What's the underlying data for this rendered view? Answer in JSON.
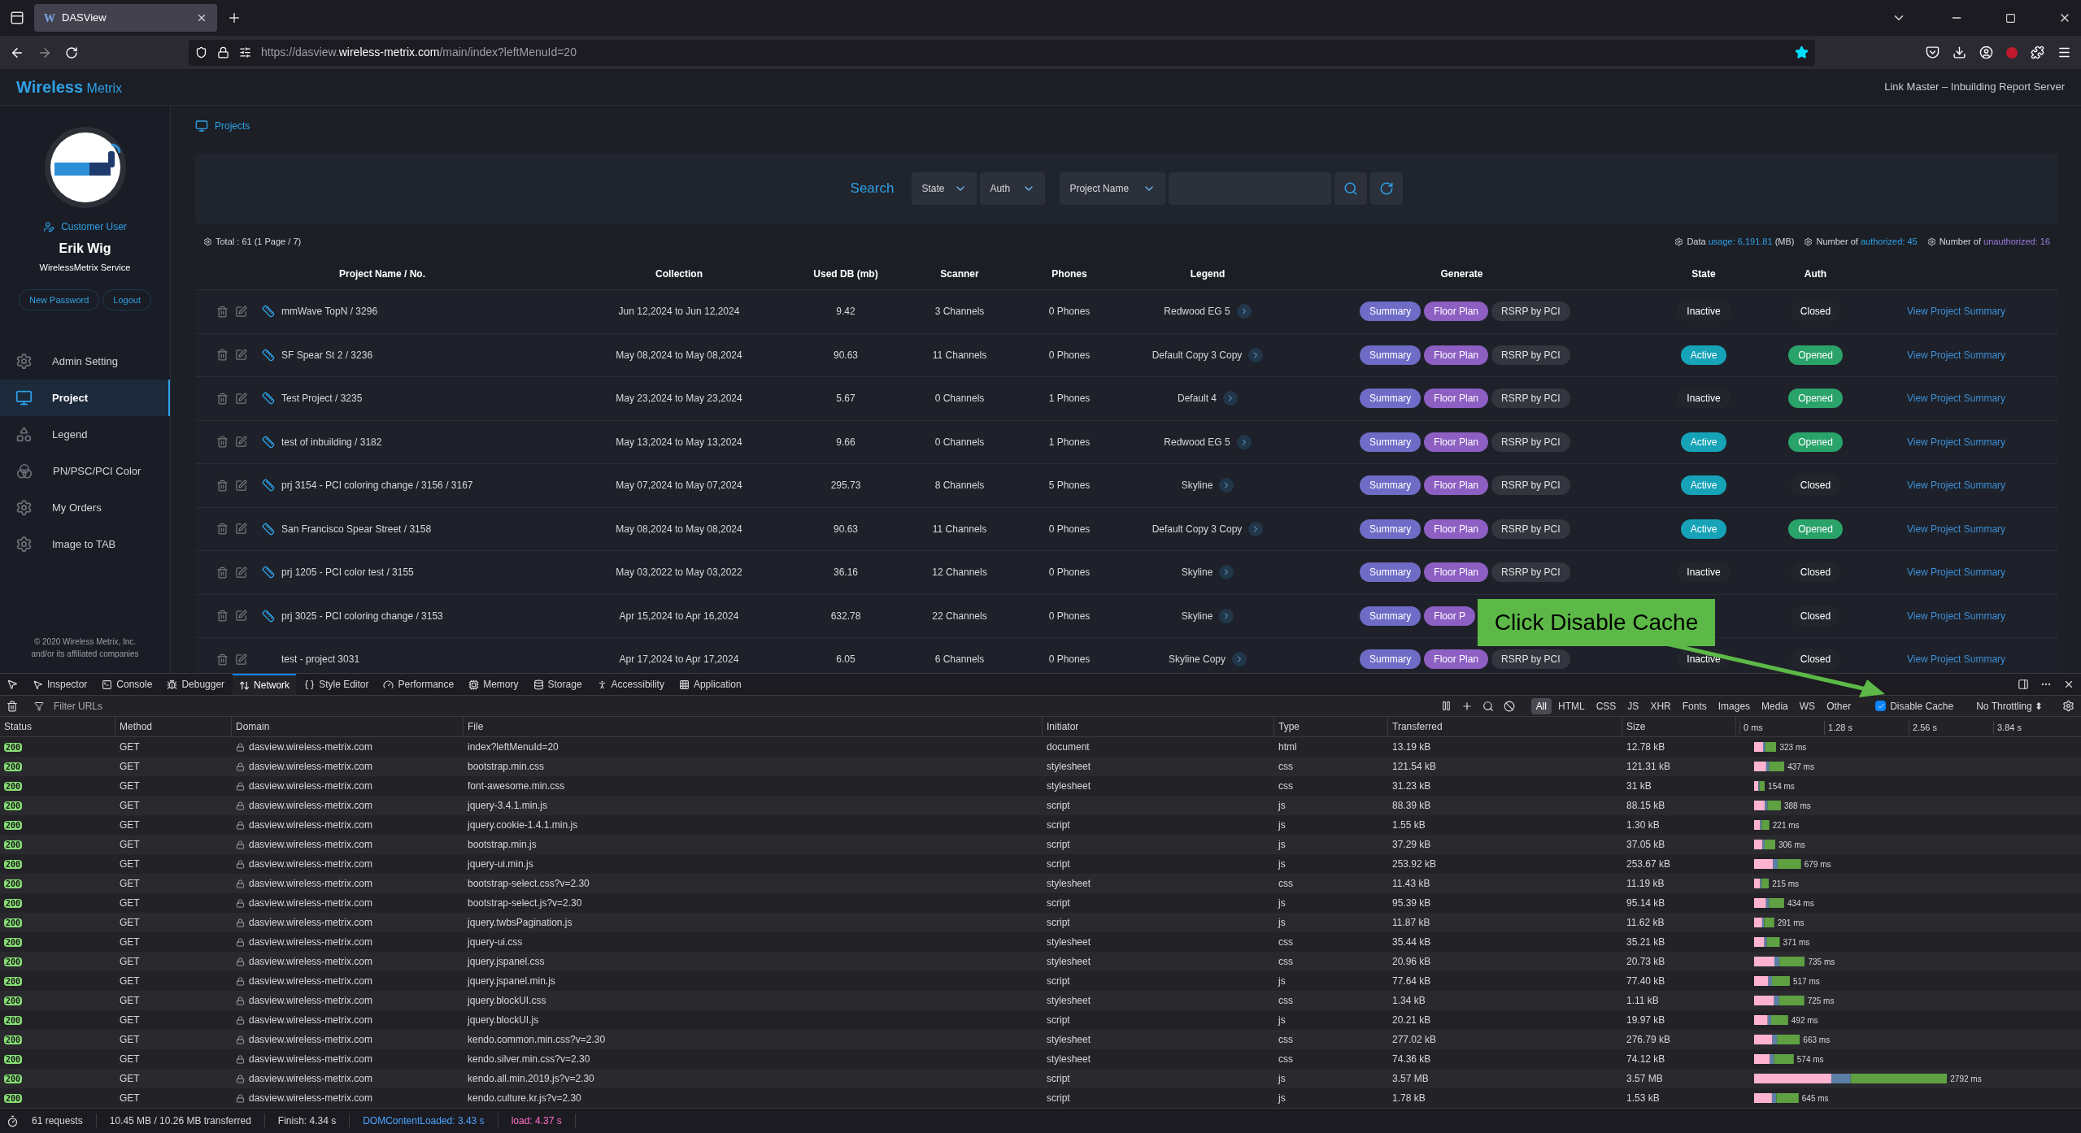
{
  "browser": {
    "tab": {
      "favicon": "W",
      "title": "DASView"
    },
    "url": {
      "scheme": "https://",
      "domain_pre": "dasview.",
      "domain": "wireless-metrix.com",
      "path": "/main/index?leftMenuId=20"
    }
  },
  "header": {
    "brand": "Wireless",
    "brand_sub": "Metrix",
    "tagline": "Link Master – Inbuilding Report Server"
  },
  "sidebar": {
    "role": "Customer User",
    "user": "Erik Wig",
    "company": "WirelessMetrix Service",
    "buttons": [
      "New Password",
      "Logout"
    ],
    "items": [
      {
        "label": "Admin Setting",
        "selected": false
      },
      {
        "label": "Project",
        "selected": true
      },
      {
        "label": "Legend",
        "selected": false
      },
      {
        "label": "PN/PSC/PCI Color",
        "selected": false
      },
      {
        "label": "My Orders",
        "selected": false
      },
      {
        "label": "Image to TAB",
        "selected": false
      }
    ],
    "footer": [
      "© 2020 Wireless Metrix, Inc.",
      "and/or its affiliated companies"
    ]
  },
  "breadcrumb": "Projects",
  "search": {
    "label": "Search",
    "dropdowns": [
      "State",
      "Auth",
      "Project Name"
    ]
  },
  "summary": {
    "total": "Total : 61 (1 Page / 7)",
    "stats": [
      {
        "pre": "Data",
        "value": "usage: 6,191.81",
        "post": "(MB)",
        "kind": "data"
      },
      {
        "pre": "Number of",
        "value": "authorized: 45",
        "kind": "data"
      },
      {
        "pre": "Number of",
        "value": "unauthorized: 16",
        "kind": "alt"
      }
    ]
  },
  "table": {
    "columns": [
      "Project Name / No.",
      "Collection",
      "Used DB (mb)",
      "Scanner",
      "Phones",
      "Legend",
      "Generate",
      "State",
      "Auth"
    ],
    "rows": [
      {
        "name": "mmWave TopN / 3296",
        "linked": true,
        "collection": "Jun 12,2024 to Jun 12,2024",
        "used_db": "9.42",
        "scanner": "3 Channels",
        "phones": "0 Phones",
        "legend": "Redwood EG 5",
        "generate": [
          {
            "label": "Summary",
            "kind": "summary"
          },
          {
            "label": "Floor Plan",
            "kind": "floor"
          },
          {
            "label": "RSRP by PCI",
            "kind": "plain"
          }
        ],
        "state": {
          "label": "Inactive",
          "active": false
        },
        "auth": {
          "label": "Closed",
          "opened": false
        },
        "link": "View Project Summary"
      },
      {
        "name": "SF Spear St 2 / 3236",
        "linked": true,
        "collection": "May 08,2024 to May 08,2024",
        "used_db": "90.63",
        "scanner": "11 Channels",
        "phones": "0 Phones",
        "legend": "Default Copy 3 Copy",
        "generate": [
          {
            "label": "Summary",
            "kind": "summary"
          },
          {
            "label": "Floor Plan",
            "kind": "floor"
          },
          {
            "label": "RSRP by PCI",
            "kind": "plain"
          }
        ],
        "state": {
          "label": "Active",
          "active": true
        },
        "auth": {
          "label": "Opened",
          "opened": true
        },
        "link": "View Project Summary"
      },
      {
        "name": "Test Project / 3235",
        "linked": true,
        "collection": "May 23,2024 to May 23,2024",
        "used_db": "5.67",
        "scanner": "0 Channels",
        "phones": "1 Phones",
        "legend": "Default 4",
        "generate": [
          {
            "label": "Summary",
            "kind": "summary"
          },
          {
            "label": "Floor Plan",
            "kind": "floor"
          },
          {
            "label": "RSRP by PCI",
            "kind": "plain"
          }
        ],
        "state": {
          "label": "Inactive",
          "active": false
        },
        "auth": {
          "label": "Opened",
          "opened": true
        },
        "link": "View Project Summary"
      },
      {
        "name": "test of inbuilding / 3182",
        "linked": true,
        "collection": "May 13,2024 to May 13,2024",
        "used_db": "9.66",
        "scanner": "0 Channels",
        "phones": "1 Phones",
        "legend": "Redwood EG 5",
        "generate": [
          {
            "label": "Summary",
            "kind": "summary"
          },
          {
            "label": "Floor Plan",
            "kind": "floor"
          },
          {
            "label": "RSRP by PCI",
            "kind": "plain"
          }
        ],
        "state": {
          "label": "Active",
          "active": true
        },
        "auth": {
          "label": "Opened",
          "opened": true
        },
        "link": "View Project Summary"
      },
      {
        "name": "prj 3154 - PCI coloring change / 3156 / 3167",
        "linked": true,
        "collection": "May 07,2024 to May 07,2024",
        "used_db": "295.73",
        "scanner": "8 Channels",
        "phones": "5 Phones",
        "legend": "Skyline",
        "generate": [
          {
            "label": "Summary",
            "kind": "summary"
          },
          {
            "label": "Floor Plan",
            "kind": "floor"
          },
          {
            "label": "RSRP by PCI",
            "kind": "plain"
          }
        ],
        "state": {
          "label": "Active",
          "active": true
        },
        "auth": {
          "label": "Closed",
          "opened": false
        },
        "link": "View Project Summary"
      },
      {
        "name": "San Francisco Spear Street / 3158",
        "linked": true,
        "collection": "May 08,2024 to May 08,2024",
        "used_db": "90.63",
        "scanner": "11 Channels",
        "phones": "0 Phones",
        "legend": "Default Copy 3 Copy",
        "generate": [
          {
            "label": "Summary",
            "kind": "summary"
          },
          {
            "label": "Floor Plan",
            "kind": "floor"
          },
          {
            "label": "RSRP by PCI",
            "kind": "plain"
          }
        ],
        "state": {
          "label": "Active",
          "active": true
        },
        "auth": {
          "label": "Opened",
          "opened": true
        },
        "link": "View Project Summary"
      },
      {
        "name": "prj 1205 - PCI color test / 3155",
        "linked": true,
        "collection": "May 03,2022 to May 03,2022",
        "used_db": "36.16",
        "scanner": "12 Channels",
        "phones": "0 Phones",
        "legend": "Skyline",
        "generate": [
          {
            "label": "Summary",
            "kind": "summary"
          },
          {
            "label": "Floor Plan",
            "kind": "floor"
          },
          {
            "label": "RSRP by PCI",
            "kind": "plain"
          }
        ],
        "state": {
          "label": "Inactive",
          "active": false
        },
        "auth": {
          "label": "Closed",
          "opened": false
        },
        "link": "View Project Summary"
      },
      {
        "name": "prj 3025 - PCI coloring change / 3153",
        "linked": true,
        "collection": "Apr 15,2024 to Apr 16,2024",
        "used_db": "632.78",
        "scanner": "22 Channels",
        "phones": "0 Phones",
        "legend": "Skyline",
        "generate": [
          {
            "label": "Summary",
            "kind": "summary"
          },
          {
            "label": "Floor P",
            "kind": "floor"
          }
        ],
        "auth": {
          "label": "Closed",
          "opened": false
        },
        "link": "View Project Summary"
      },
      {
        "name": "test - project 3031",
        "linked": false,
        "collection": "Apr 17,2024 to Apr 17,2024",
        "used_db": "6.05",
        "scanner": "6 Channels",
        "phones": "0 Phones",
        "legend": "Skyline Copy",
        "generate": [
          {
            "label": "Summary",
            "kind": "summary"
          },
          {
            "label": "Floor Plan",
            "kind": "floor"
          },
          {
            "label": "RSRP by PCI",
            "kind": "plain"
          }
        ],
        "state": {
          "label": "Inactive",
          "active": false
        },
        "auth": {
          "label": "Closed",
          "opened": false
        },
        "link": "View Project Summary"
      }
    ]
  },
  "annotation": {
    "text": "Click Disable Cache"
  },
  "devtools": {
    "tabs": [
      {
        "label": "Inspector",
        "selected": false
      },
      {
        "label": "Console",
        "selected": false
      },
      {
        "label": "Debugger",
        "selected": false
      },
      {
        "label": "Network",
        "selected": true
      },
      {
        "label": "Style Editor",
        "selected": false
      },
      {
        "label": "Performance",
        "selected": false
      },
      {
        "label": "Memory",
        "selected": false
      },
      {
        "label": "Storage",
        "selected": false
      },
      {
        "label": "Accessibility",
        "selected": false
      },
      {
        "label": "Application",
        "selected": false
      }
    ],
    "filter_placeholder": "Filter URLs",
    "type_filters": [
      {
        "label": "All",
        "selected": true
      },
      {
        "label": "HTML",
        "selected": false
      },
      {
        "label": "CSS",
        "selected": false
      },
      {
        "label": "JS",
        "selected": false
      },
      {
        "label": "XHR",
        "selected": false
      },
      {
        "label": "Fonts",
        "selected": false
      },
      {
        "label": "Images",
        "selected": false
      },
      {
        "label": "Media",
        "selected": false
      },
      {
        "label": "WS",
        "selected": false
      },
      {
        "label": "Other",
        "selected": false
      }
    ],
    "disable_cache": {
      "label": "Disable Cache",
      "checked": true
    },
    "throttling": "No Throttling ⬍",
    "columns": [
      "Status",
      "Method",
      "Domain",
      "File",
      "Initiator",
      "Type",
      "Transferred",
      "Size"
    ],
    "ticks": [
      "0 ms",
      "1.28 s",
      "2.56 s",
      "3.84 s"
    ],
    "requests": [
      {
        "status": "200",
        "method": "GET",
        "domain": "dasview.wireless-metrix.com",
        "file": "index?leftMenuId=20",
        "initiator": "document",
        "type": "html",
        "transferred": "13.19 kB",
        "size": "12.78 kB",
        "time": "323 ms"
      },
      {
        "status": "200",
        "method": "GET",
        "domain": "dasview.wireless-metrix.com",
        "file": "bootstrap.min.css",
        "initiator": "stylesheet",
        "type": "css",
        "transferred": "121.54 kB",
        "size": "121.31 kB",
        "time": "437 ms"
      },
      {
        "status": "200",
        "method": "GET",
        "domain": "dasview.wireless-metrix.com",
        "file": "font-awesome.min.css",
        "initiator": "stylesheet",
        "type": "css",
        "transferred": "31.23 kB",
        "size": "31 kB",
        "time": "154 ms"
      },
      {
        "status": "200",
        "method": "GET",
        "domain": "dasview.wireless-metrix.com",
        "file": "jquery-3.4.1.min.js",
        "initiator": "script",
        "type": "js",
        "transferred": "88.39 kB",
        "size": "88.15 kB",
        "time": "388 ms"
      },
      {
        "status": "200",
        "method": "GET",
        "domain": "dasview.wireless-metrix.com",
        "file": "jquery.cookie-1.4.1.min.js",
        "initiator": "script",
        "type": "js",
        "transferred": "1.55 kB",
        "size": "1.30 kB",
        "time": "221 ms"
      },
      {
        "status": "200",
        "method": "GET",
        "domain": "dasview.wireless-metrix.com",
        "file": "bootstrap.min.js",
        "initiator": "script",
        "type": "js",
        "transferred": "37.29 kB",
        "size": "37.05 kB",
        "time": "306 ms"
      },
      {
        "status": "200",
        "method": "GET",
        "domain": "dasview.wireless-metrix.com",
        "file": "jquery-ui.min.js",
        "initiator": "script",
        "type": "js",
        "transferred": "253.92 kB",
        "size": "253.67 kB",
        "time": "679 ms"
      },
      {
        "status": "200",
        "method": "GET",
        "domain": "dasview.wireless-metrix.com",
        "file": "bootstrap-select.css?v=2.30",
        "initiator": "stylesheet",
        "type": "css",
        "transferred": "11.43 kB",
        "size": "11.19 kB",
        "time": "215 ms"
      },
      {
        "status": "200",
        "method": "GET",
        "domain": "dasview.wireless-metrix.com",
        "file": "bootstrap-select.js?v=2.30",
        "initiator": "script",
        "type": "js",
        "transferred": "95.39 kB",
        "size": "95.14 kB",
        "time": "434 ms"
      },
      {
        "status": "200",
        "method": "GET",
        "domain": "dasview.wireless-metrix.com",
        "file": "jquery.twbsPagination.js",
        "initiator": "script",
        "type": "js",
        "transferred": "11.87 kB",
        "size": "11.62 kB",
        "time": "291 ms"
      },
      {
        "status": "200",
        "method": "GET",
        "domain": "dasview.wireless-metrix.com",
        "file": "jquery-ui.css",
        "initiator": "stylesheet",
        "type": "css",
        "transferred": "35.44 kB",
        "size": "35.21 kB",
        "time": "371 ms"
      },
      {
        "status": "200",
        "method": "GET",
        "domain": "dasview.wireless-metrix.com",
        "file": "jquery.jspanel.css",
        "initiator": "stylesheet",
        "type": "css",
        "transferred": "20.96 kB",
        "size": "20.73 kB",
        "time": "735 ms"
      },
      {
        "status": "200",
        "method": "GET",
        "domain": "dasview.wireless-metrix.com",
        "file": "jquery.jspanel.min.js",
        "initiator": "script",
        "type": "js",
        "transferred": "77.64 kB",
        "size": "77.40 kB",
        "time": "517 ms"
      },
      {
        "status": "200",
        "method": "GET",
        "domain": "dasview.wireless-metrix.com",
        "file": "jquery.blockUI.css",
        "initiator": "stylesheet",
        "type": "css",
        "transferred": "1.34 kB",
        "size": "1.11 kB",
        "time": "725 ms"
      },
      {
        "status": "200",
        "method": "GET",
        "domain": "dasview.wireless-metrix.com",
        "file": "jquery.blockUI.js",
        "initiator": "script",
        "type": "js",
        "transferred": "20.21 kB",
        "size": "19.97 kB",
        "time": "492 ms"
      },
      {
        "status": "200",
        "method": "GET",
        "domain": "dasview.wireless-metrix.com",
        "file": "kendo.common.min.css?v=2.30",
        "initiator": "stylesheet",
        "type": "css",
        "transferred": "277.02 kB",
        "size": "276.79 kB",
        "time": "663 ms"
      },
      {
        "status": "200",
        "method": "GET",
        "domain": "dasview.wireless-metrix.com",
        "file": "kendo.silver.min.css?v=2.30",
        "initiator": "stylesheet",
        "type": "css",
        "transferred": "74.36 kB",
        "size": "74.12 kB",
        "time": "574 ms"
      },
      {
        "status": "200",
        "method": "GET",
        "domain": "dasview.wireless-metrix.com",
        "file": "kendo.all.min.2019.js?v=2.30",
        "initiator": "script",
        "type": "js",
        "transferred": "3.57 MB",
        "size": "3.57 MB",
        "time": "2792 ms"
      },
      {
        "status": "200",
        "method": "GET",
        "domain": "dasview.wireless-metrix.com",
        "file": "kendo.culture.kr.js?v=2.30",
        "initiator": "script",
        "type": "js",
        "transferred": "1.78 kB",
        "size": "1.53 kB",
        "time": "645 ms"
      }
    ],
    "status_bar": [
      {
        "text": "61 requests",
        "kind": "plain"
      },
      {
        "text": "10.45 MB / 10.26 MB transferred",
        "kind": "plain"
      },
      {
        "text": "Finish: 4.34 s",
        "kind": "plain"
      },
      {
        "text": "DOMContentLoaded: 3.43 s",
        "kind": "dom"
      },
      {
        "text": "load: 4.37 s",
        "kind": "load"
      }
    ]
  }
}
